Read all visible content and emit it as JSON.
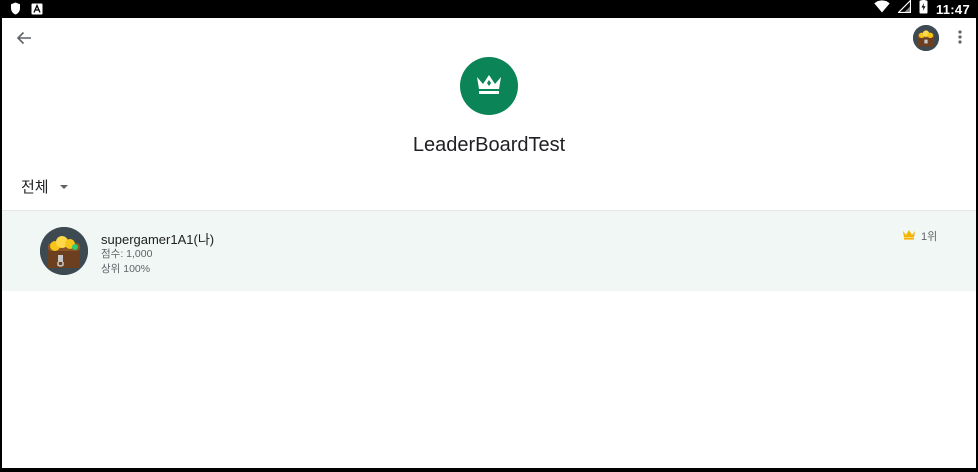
{
  "status_bar": {
    "time": "11:47",
    "notification_icons": [
      "shield-icon",
      "a-icon"
    ],
    "system_icons": [
      "wifi-icon",
      "signal-icon",
      "battery-icon"
    ]
  },
  "app": {
    "title": "LeaderBoardTest",
    "filter": {
      "selected": "전체"
    },
    "leaderboard": {
      "rows": [
        {
          "name": "supergamer1A1(나)",
          "score": "점수: 1,000",
          "percentile": "상위 100%",
          "rank": "1위"
        }
      ]
    }
  },
  "colors": {
    "accent": "#0b8457",
    "row_highlight": "#f1f7f5",
    "crown_gold": "#f5b400"
  }
}
